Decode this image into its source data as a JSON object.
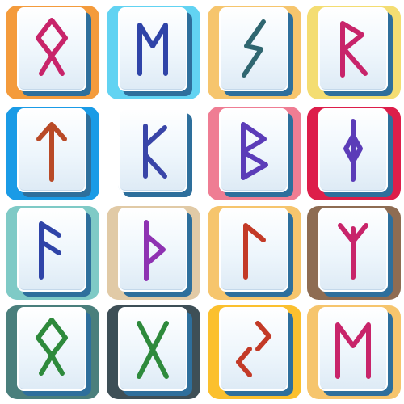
{
  "tiles": [
    {
      "glyph": "othala-rune-icon",
      "plate": "#f49b3c",
      "ink": "#c8246a"
    },
    {
      "glyph": "ehwaz-rune-icon",
      "plate": "#62d3f2",
      "ink": "#2f44a8"
    },
    {
      "glyph": "sowilo-rune-icon",
      "plate": "#f6c56d",
      "ink": "#2f6670"
    },
    {
      "glyph": "raidho-rune-icon",
      "plate": "#f4dd72",
      "ink": "#c8246a"
    },
    {
      "glyph": "tiwaz-rune-icon",
      "plate": "#1a9be6",
      "ink": "#b94a27"
    },
    {
      "glyph": "perthro-rune-icon",
      "plate": "#ffffff",
      "ink": "#3945a8"
    },
    {
      "glyph": "berkano-rune-icon",
      "plate": "#ef7d93",
      "ink": "#5b3cb8"
    },
    {
      "glyph": "ingwaz-rune-icon",
      "plate": "#dd1e4a",
      "ink": "#5b3cb8"
    },
    {
      "glyph": "ansuz-rune-icon",
      "plate": "#7fcac6",
      "ink": "#2f44a8"
    },
    {
      "glyph": "thurisaz-rune-icon",
      "plate": "#e1caa6",
      "ink": "#8e32b2"
    },
    {
      "glyph": "laguz-rune-icon",
      "plate": "#f6c56d",
      "ink": "#c33a27"
    },
    {
      "glyph": "algiz-rune-icon",
      "plate": "#8e6c52",
      "ink": "#c8246a"
    },
    {
      "glyph": "othala-rune-icon",
      "plate": "#4a7f7c",
      "ink": "#2e8a3c"
    },
    {
      "glyph": "gebo-rune-icon",
      "plate": "#3e4f56",
      "ink": "#2e8a3c"
    },
    {
      "glyph": "jera-rune-icon",
      "plate": "#fbc02e",
      "ink": "#c33a27"
    },
    {
      "glyph": "mannaz-rune-icon",
      "plate": "#f6c56d",
      "ink": "#c8246a"
    }
  ]
}
